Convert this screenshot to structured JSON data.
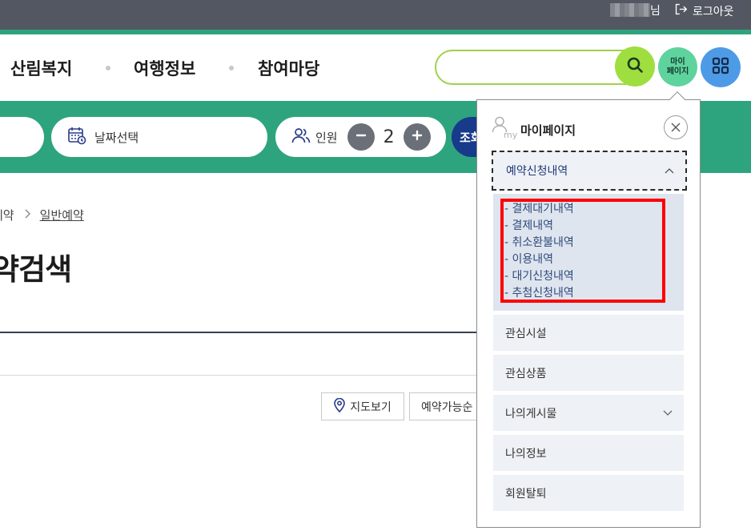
{
  "topbar": {
    "user_suffix": "님",
    "logout_label": "로그아웃"
  },
  "nav": {
    "items": [
      {
        "label": "산림복지"
      },
      {
        "label": "여행정보"
      },
      {
        "label": "참여마당"
      }
    ]
  },
  "search": {
    "placeholder": ""
  },
  "header_buttons": {
    "mypage_line1": "마이",
    "mypage_line2": "페이지"
  },
  "filter": {
    "date_label": "날짜선택",
    "people_label": "인원",
    "people_count": "2",
    "query_label": "조회"
  },
  "breadcrumb": {
    "prev": "예약",
    "current": "일반예약"
  },
  "main": {
    "title": "약검색",
    "map_button": "지도보기",
    "sort_button": "예약가능순"
  },
  "mypage_panel": {
    "my_tag": "my",
    "title": "마이페이지",
    "active_menu": "예약신청내역",
    "submenu": [
      "- 결제대기내역",
      "- 결제내역",
      "- 취소환불내역",
      "- 이용내역",
      "- 대기신청내역",
      "- 추첨신청내역"
    ],
    "menu_items": [
      {
        "label": "관심시설",
        "has_chevron": false
      },
      {
        "label": "관심상품",
        "has_chevron": false
      },
      {
        "label": "나의게시물",
        "has_chevron": true
      },
      {
        "label": "나의정보",
        "has_chevron": false
      },
      {
        "label": "회원탈퇴",
        "has_chevron": false
      }
    ]
  },
  "colors": {
    "topbar": "#535761",
    "brand_green": "#2ea47e",
    "search_green": "#9fde3f",
    "mypage_mint": "#5ed39e",
    "grid_blue": "#4d9be6",
    "query_navy": "#173a8a",
    "highlight_red": "#ff0000"
  }
}
